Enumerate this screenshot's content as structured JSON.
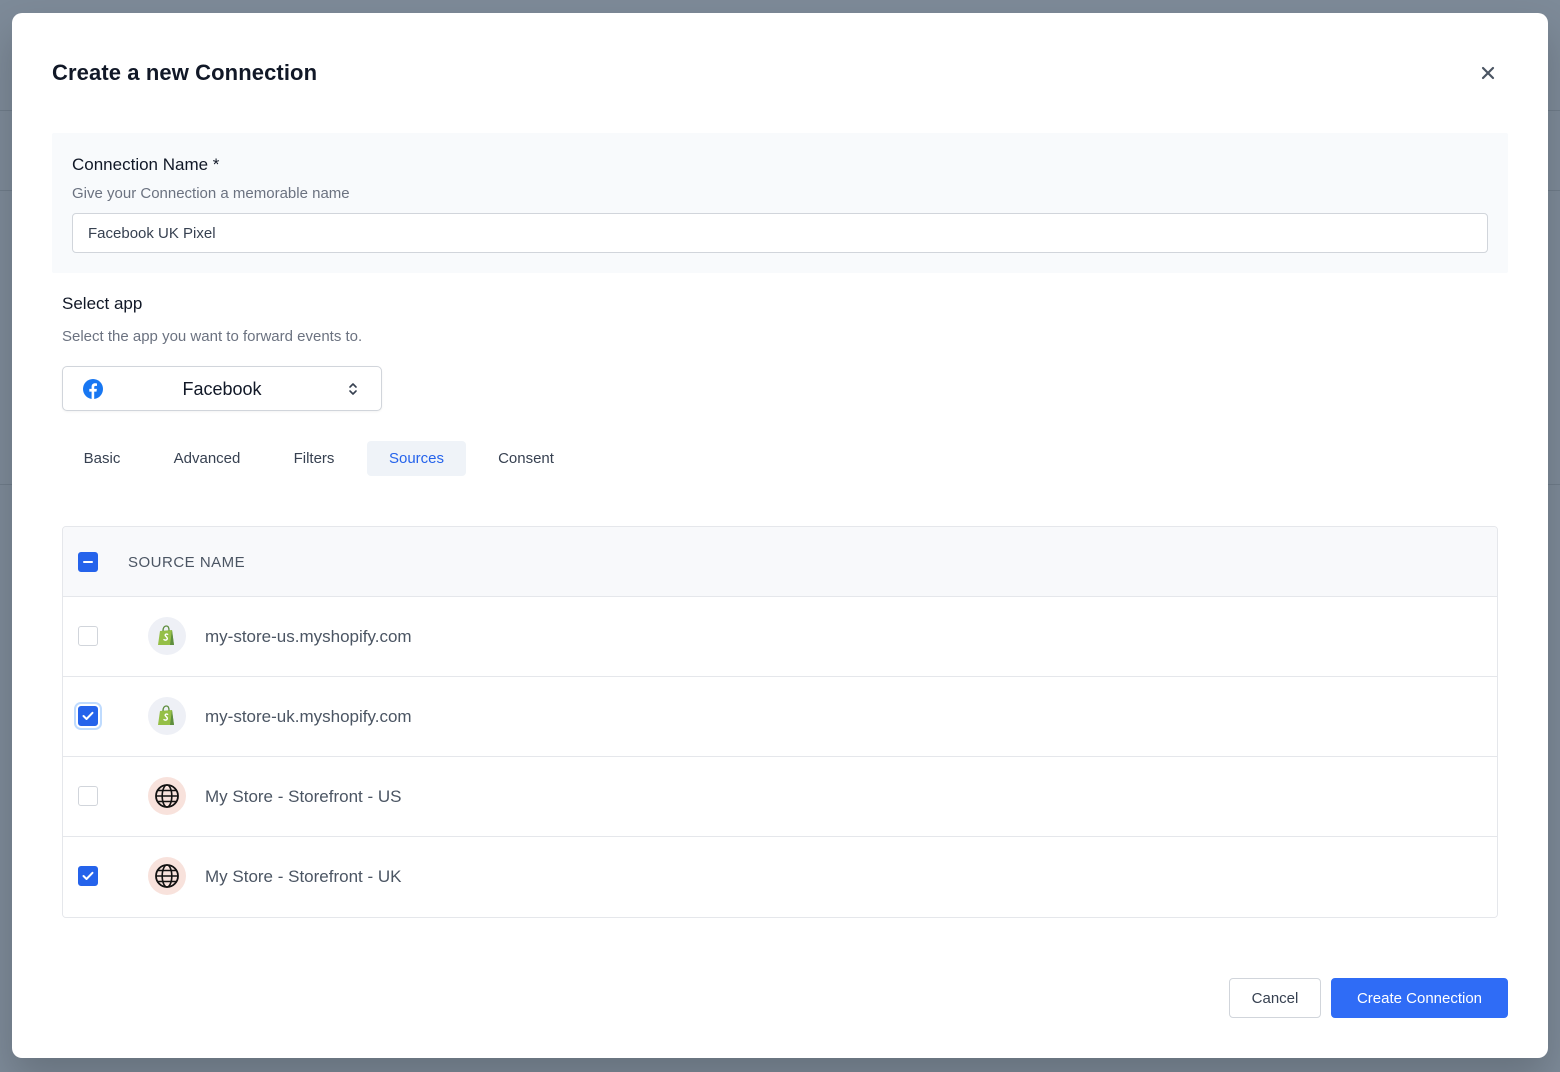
{
  "modal": {
    "title": "Create a new Connection",
    "close_icon": "close-icon"
  },
  "connection_name": {
    "label": "Connection Name *",
    "help": "Give your Connection a memorable name",
    "value": "Facebook UK Pixel"
  },
  "select_app": {
    "title": "Select app",
    "help": "Select the app you want to forward events to.",
    "selected": "Facebook",
    "icon": "facebook-icon"
  },
  "tabs": [
    {
      "label": "Basic",
      "active": false
    },
    {
      "label": "Advanced",
      "active": false
    },
    {
      "label": "Filters",
      "active": false
    },
    {
      "label": "Sources",
      "active": true
    },
    {
      "label": "Consent",
      "active": false
    }
  ],
  "sources_table": {
    "header": "SOURCE NAME",
    "header_checkbox": "indeterminate",
    "rows": [
      {
        "name": "my-store-us.myshopify.com",
        "icon": "shopify-icon",
        "checked": false
      },
      {
        "name": "my-store-uk.myshopify.com",
        "icon": "shopify-icon",
        "checked": true
      },
      {
        "name": "My Store - Storefront - US",
        "icon": "globe-icon",
        "checked": false
      },
      {
        "name": "My Store - Storefront - UK",
        "icon": "globe-icon",
        "checked": true
      }
    ]
  },
  "footer": {
    "cancel_label": "Cancel",
    "create_label": "Create Connection"
  },
  "colors": {
    "accent": "#2563eb",
    "primary_button": "#2f6cf6",
    "backdrop": "#7d8a98",
    "facebook": "#1877f2",
    "shopify": "#95bf47"
  }
}
